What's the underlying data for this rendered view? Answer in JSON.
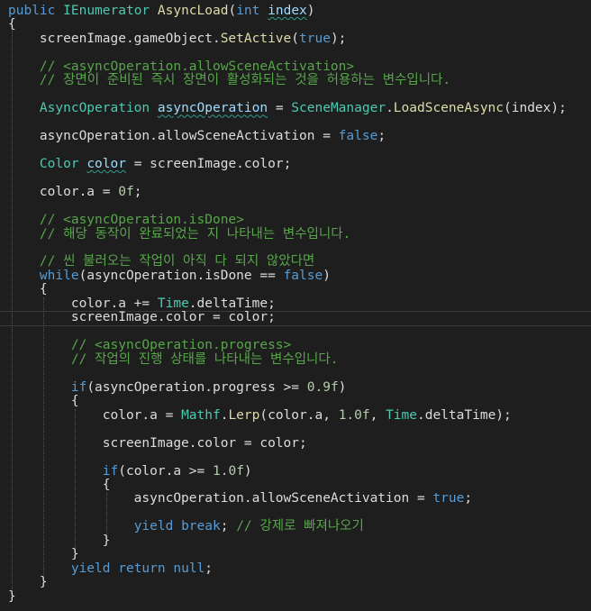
{
  "code_lines": [
    [
      {
        "t": "public",
        "c": "kw"
      },
      {
        "t": " "
      },
      {
        "t": "IEnumerator",
        "c": "ty"
      },
      {
        "t": " "
      },
      {
        "t": "AsyncLoad",
        "c": "fn"
      },
      {
        "t": "("
      },
      {
        "t": "int",
        "c": "kw"
      },
      {
        "t": " "
      },
      {
        "t": "index",
        "c": "vr",
        "sq": true
      },
      {
        "t": ")"
      }
    ],
    [
      {
        "t": "{"
      }
    ],
    [
      {
        "t": "    screenImage.gameObject."
      },
      {
        "t": "SetActive",
        "c": "fn"
      },
      {
        "t": "("
      },
      {
        "t": "true",
        "c": "kw"
      },
      {
        "t": ");"
      }
    ],
    [
      {
        "t": ""
      }
    ],
    [
      {
        "t": "    // <asyncOperation.allowSceneActivation>",
        "c": "cm"
      }
    ],
    [
      {
        "t": "    // 장면이 준비된 즉시 장면이 활성화되는 것을 허용하는 변수입니다.",
        "c": "cm"
      }
    ],
    [
      {
        "t": ""
      }
    ],
    [
      {
        "t": "    "
      },
      {
        "t": "AsyncOperation",
        "c": "ty"
      },
      {
        "t": " "
      },
      {
        "t": "asyncOperation",
        "c": "vr",
        "sq": true
      },
      {
        "t": " = "
      },
      {
        "t": "SceneManager",
        "c": "ty"
      },
      {
        "t": "."
      },
      {
        "t": "LoadSceneAsync",
        "c": "fn"
      },
      {
        "t": "(index);"
      }
    ],
    [
      {
        "t": ""
      }
    ],
    [
      {
        "t": "    asyncOperation.allowSceneActivation = "
      },
      {
        "t": "false",
        "c": "kw"
      },
      {
        "t": ";"
      }
    ],
    [
      {
        "t": ""
      }
    ],
    [
      {
        "t": "    "
      },
      {
        "t": "Color",
        "c": "ty"
      },
      {
        "t": " "
      },
      {
        "t": "color",
        "c": "vr",
        "sq": true
      },
      {
        "t": " = screenImage.color;"
      }
    ],
    [
      {
        "t": ""
      }
    ],
    [
      {
        "t": "    color.a = "
      },
      {
        "t": "0f",
        "c": "nm"
      },
      {
        "t": ";"
      }
    ],
    [
      {
        "t": ""
      }
    ],
    [
      {
        "t": "    // <asyncOperation.isDone>",
        "c": "cm"
      }
    ],
    [
      {
        "t": "    // 해당 동작이 완료되었는 지 나타내는 변수입니다.",
        "c": "cm"
      }
    ],
    [
      {
        "t": ""
      }
    ],
    [
      {
        "t": "    // 씬 불러오는 작업이 아직 다 되지 않았다면",
        "c": "cm"
      }
    ],
    [
      {
        "t": "    "
      },
      {
        "t": "while",
        "c": "kw"
      },
      {
        "t": "(asyncOperation.isDone == "
      },
      {
        "t": "false",
        "c": "kw"
      },
      {
        "t": ")"
      }
    ],
    [
      {
        "t": "    {"
      }
    ],
    [
      {
        "t": "        color.a += "
      },
      {
        "t": "Time",
        "c": "ty"
      },
      {
        "t": ".deltaTime;"
      }
    ],
    [
      {
        "t": "        screenImage.color = color;"
      }
    ],
    [
      {
        "t": ""
      }
    ],
    [
      {
        "t": "        // <asyncOperation.progress>",
        "c": "cm"
      }
    ],
    [
      {
        "t": "        // 작업의 진행 상태를 나타내는 변수입니다.",
        "c": "cm"
      }
    ],
    [
      {
        "t": ""
      }
    ],
    [
      {
        "t": "        "
      },
      {
        "t": "if",
        "c": "kw"
      },
      {
        "t": "(asyncOperation.progress >= "
      },
      {
        "t": "0.9f",
        "c": "nm"
      },
      {
        "t": ")"
      }
    ],
    [
      {
        "t": "        {"
      }
    ],
    [
      {
        "t": "            color.a = "
      },
      {
        "t": "Mathf",
        "c": "ty"
      },
      {
        "t": "."
      },
      {
        "t": "Lerp",
        "c": "fn"
      },
      {
        "t": "(color.a, "
      },
      {
        "t": "1.0f",
        "c": "nm"
      },
      {
        "t": ", "
      },
      {
        "t": "Time",
        "c": "ty"
      },
      {
        "t": ".deltaTime);"
      }
    ],
    [
      {
        "t": ""
      }
    ],
    [
      {
        "t": "            screenImage.color = color;"
      }
    ],
    [
      {
        "t": ""
      }
    ],
    [
      {
        "t": "            "
      },
      {
        "t": "if",
        "c": "kw"
      },
      {
        "t": "(color.a >= "
      },
      {
        "t": "1.0f",
        "c": "nm"
      },
      {
        "t": ")"
      }
    ],
    [
      {
        "t": "            {"
      }
    ],
    [
      {
        "t": "                asyncOperation.allowSceneActivation = "
      },
      {
        "t": "true",
        "c": "kw"
      },
      {
        "t": ";"
      }
    ],
    [
      {
        "t": ""
      }
    ],
    [
      {
        "t": "                "
      },
      {
        "t": "yield",
        "c": "kw"
      },
      {
        "t": " "
      },
      {
        "t": "break",
        "c": "kw"
      },
      {
        "t": "; "
      },
      {
        "t": "// 강제로 빠져나오기",
        "c": "cm"
      }
    ],
    [
      {
        "t": "            }"
      }
    ],
    [
      {
        "t": "        }"
      }
    ],
    [
      {
        "t": "        "
      },
      {
        "t": "yield",
        "c": "kw"
      },
      {
        "t": " "
      },
      {
        "t": "return",
        "c": "kw"
      },
      {
        "t": " "
      },
      {
        "t": "null",
        "c": "kw"
      },
      {
        "t": ";"
      }
    ],
    [
      {
        "t": "    }"
      }
    ],
    [
      {
        "t": "}"
      }
    ]
  ],
  "colors": {
    "background": "#1e1e1e",
    "keyword": "#569cd6",
    "type": "#4ec9b0",
    "method": "#dcdcaa",
    "parameter": "#9cdcfe",
    "comment": "#57a64a",
    "number": "#b5cea8",
    "plain": "#dcdcdc"
  }
}
